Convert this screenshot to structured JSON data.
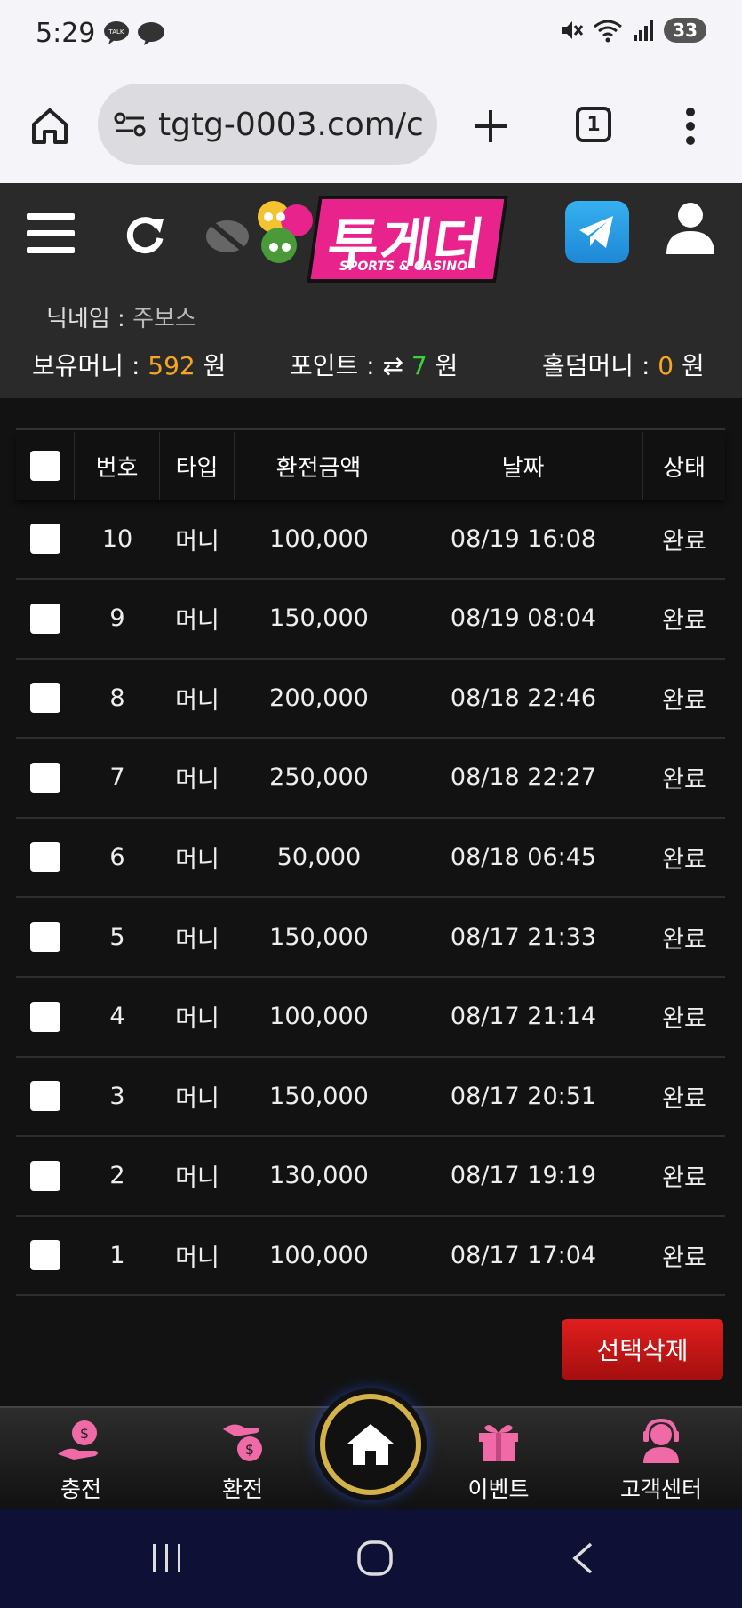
{
  "status_bar": {
    "time": "5:29",
    "battery": "33",
    "talk_label": "TALK"
  },
  "browser": {
    "url": "tgtg-0003.com/c",
    "tab_count": "1"
  },
  "site": {
    "logo": "투게더",
    "logo_sub": "SPORTS & CASINO",
    "nickname_label": "닉네임 :",
    "nickname_value": "주보스",
    "money_label": "보유머니 :",
    "money_value": "592",
    "money_unit": "원",
    "point_label": "포인트 :",
    "point_value": "7",
    "point_unit": "원",
    "holdem_label": "홀덤머니 :",
    "holdem_value": "0",
    "holdem_unit": "원"
  },
  "table": {
    "headers": [
      "번호",
      "타입",
      "환전금액",
      "날짜",
      "상태"
    ],
    "rows": [
      {
        "no": "10",
        "type": "머니",
        "amount": "100,000",
        "date": "08/19 16:08",
        "status": "완료"
      },
      {
        "no": "9",
        "type": "머니",
        "amount": "150,000",
        "date": "08/19 08:04",
        "status": "완료"
      },
      {
        "no": "8",
        "type": "머니",
        "amount": "200,000",
        "date": "08/18 22:46",
        "status": "완료"
      },
      {
        "no": "7",
        "type": "머니",
        "amount": "250,000",
        "date": "08/18 22:27",
        "status": "완료"
      },
      {
        "no": "6",
        "type": "머니",
        "amount": "50,000",
        "date": "08/18 06:45",
        "status": "완료"
      },
      {
        "no": "5",
        "type": "머니",
        "amount": "150,000",
        "date": "08/17 21:33",
        "status": "완료"
      },
      {
        "no": "4",
        "type": "머니",
        "amount": "100,000",
        "date": "08/17 21:14",
        "status": "완료"
      },
      {
        "no": "3",
        "type": "머니",
        "amount": "150,000",
        "date": "08/17 20:51",
        "status": "완료"
      },
      {
        "no": "2",
        "type": "머니",
        "amount": "130,000",
        "date": "08/17 19:19",
        "status": "완료"
      },
      {
        "no": "1",
        "type": "머니",
        "amount": "100,000",
        "date": "08/17 17:04",
        "status": "완료"
      }
    ],
    "delete_label": "선택삭제"
  },
  "bottom_nav": {
    "charge": "충전",
    "exchange": "환전",
    "event": "이벤트",
    "support": "고객센터"
  },
  "colors": {
    "accent_orange": "#f5a623",
    "accent_green": "#3bd33b",
    "delete_red": "#c81616",
    "logo_pink": "#e8238c"
  }
}
